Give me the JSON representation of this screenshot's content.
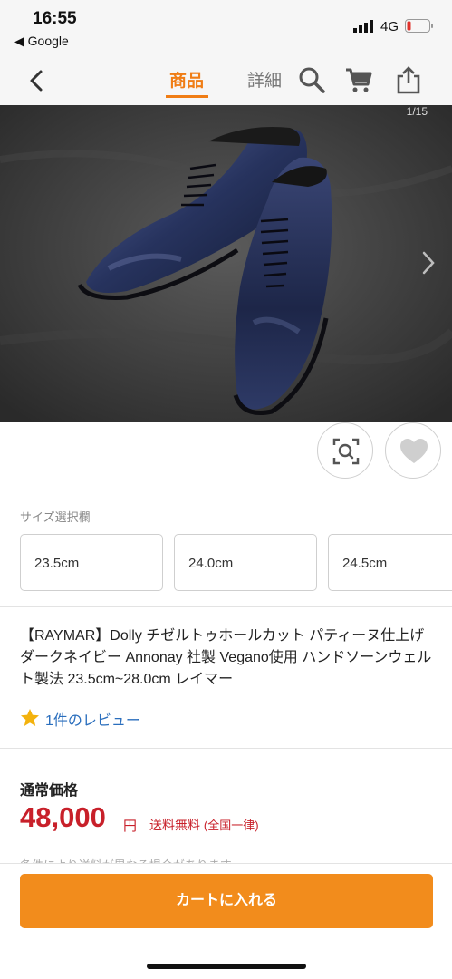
{
  "status": {
    "time": "16:55",
    "back_app": "◀ Google",
    "network": "4G"
  },
  "nav": {
    "tab_item": "商品",
    "tab_detail": "詳細"
  },
  "gallery": {
    "counter": "1/15"
  },
  "size": {
    "label": "サイズ選択欄",
    "options": [
      "23.5cm",
      "24.0cm",
      "24.5cm"
    ]
  },
  "product": {
    "title": "【RAYMAR】Dolly チゼルトゥホールカット パティーヌ仕上げ ダークネイビー Annonay 社製 Vegano使用 ハンドソーンウェルト製法 23.5cm~28.0cm レイマー",
    "review_link": "1件のレビュー"
  },
  "price": {
    "label": "通常価格",
    "value": "48,000",
    "unit": "円",
    "shipping": "送料無料",
    "shipping_note": "(全国一律)",
    "condition_note": "条件により送料が異なる場合があります"
  },
  "cart": {
    "button_label": "カートに入れる"
  },
  "colors": {
    "accent": "#f07d15",
    "price": "#c8202a",
    "link": "#2a6ebd",
    "cart": "#f28c1c"
  }
}
